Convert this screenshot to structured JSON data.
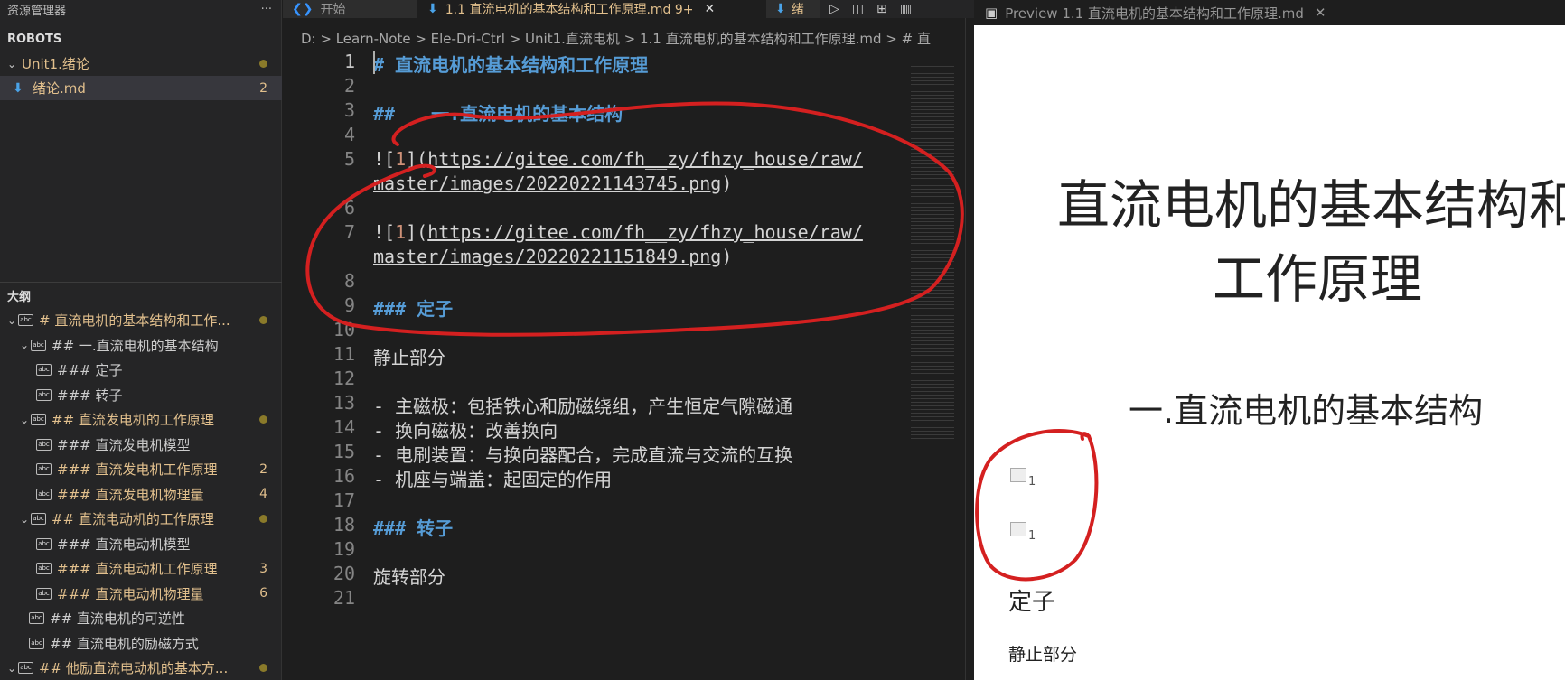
{
  "sidebar": {
    "explorer_title": "资源管理器",
    "more_label": "···",
    "workspace": "ROBOTS",
    "folder": {
      "label": "Unit1.绪论"
    },
    "file": {
      "label": "绪论.md",
      "count": "2"
    },
    "outline_title": "大纲",
    "outline": [
      {
        "label": "# 直流电机的基本结构和工作...",
        "yellow": true,
        "dot": true
      },
      {
        "label": "## 一.直流电机的基本结构",
        "yellow": false
      },
      {
        "label": "### 定子",
        "yellow": false
      },
      {
        "label": "### 转子",
        "yellow": false
      },
      {
        "label": "## 直流发电机的工作原理",
        "yellow": true,
        "dot": true
      },
      {
        "label": "### 直流发电机模型",
        "yellow": false
      },
      {
        "label": "### 直流发电机工作原理",
        "yellow": true,
        "count": "2"
      },
      {
        "label": "### 直流发电机物理量",
        "yellow": true,
        "count": "4"
      },
      {
        "label": "## 直流电动机的工作原理",
        "yellow": true,
        "dot": true
      },
      {
        "label": "### 直流电动机模型",
        "yellow": false
      },
      {
        "label": "### 直流电动机工作原理",
        "yellow": true,
        "count": "3"
      },
      {
        "label": "### 直流电动机物理量",
        "yellow": true,
        "count": "6"
      },
      {
        "label": "## 直流电机的可逆性",
        "yellow": false
      },
      {
        "label": "## 直流电机的励磁方式",
        "yellow": false
      },
      {
        "label": "## 他励直流电动机的基本方...",
        "yellow": true,
        "dot": true
      }
    ]
  },
  "editor": {
    "tabs": [
      {
        "label": "开始",
        "active": false
      },
      {
        "label": "1.1 直流电机的基本结构和工作原理.md 9+",
        "active": true
      },
      {
        "label": "绪",
        "active": false
      }
    ],
    "breadcrumb": "D: > Learn-Note > Ele-Dri-Ctrl > Unit1.直流电机 > 1.1 直流电机的基本结构和工作原理.md > # 直",
    "line_numbers": [
      "1",
      "2",
      "3",
      "4",
      "5",
      "",
      "6",
      "7",
      "",
      "8",
      "9",
      "10",
      "11",
      "12",
      "13",
      "14",
      "15",
      "16",
      "17",
      "18",
      "19",
      "20",
      "21"
    ],
    "lines": {
      "l1": "# 直流电机的基本结构和工作原理",
      "l3a": "##",
      "l3b": "一.直流电机的基本结构",
      "l5a": "![",
      "l5b": "1",
      "l5c": "](",
      "l5d": "https://gitee.com/fh__zy/fhzy_house/raw/",
      "l5e": "master/images/20220221143745.png",
      "l5f": ")",
      "l7d": "https://gitee.com/fh__zy/fhzy_house/raw/",
      "l7e": "master/images/20220221151849.png",
      "l9": "### 定子",
      "l11": "静止部分",
      "l13": "- 主磁极：包括铁心和励磁绕组，产生恒定气隙磁通",
      "l14": "- 换向磁极：改善换向",
      "l15": "- 电刷装置：与换向器配合，完成直流与交流的互换",
      "l16": "- 机座与端盖：起固定的作用",
      "l18": "### 转子",
      "l20": "旋转部分"
    }
  },
  "preview": {
    "tab_label": "Preview 1.1 直流电机的基本结构和工作原理.md",
    "title_line1": "直流电机的基本结构和",
    "title_line2": "工作原理",
    "h2": "一.直流电机的基本结构",
    "img_alt": "1",
    "h3": "定子",
    "p1": "静止部分"
  },
  "colors": {
    "annotation": "#d42020",
    "heading": "#569cd6",
    "modified": "#e2c08d"
  }
}
